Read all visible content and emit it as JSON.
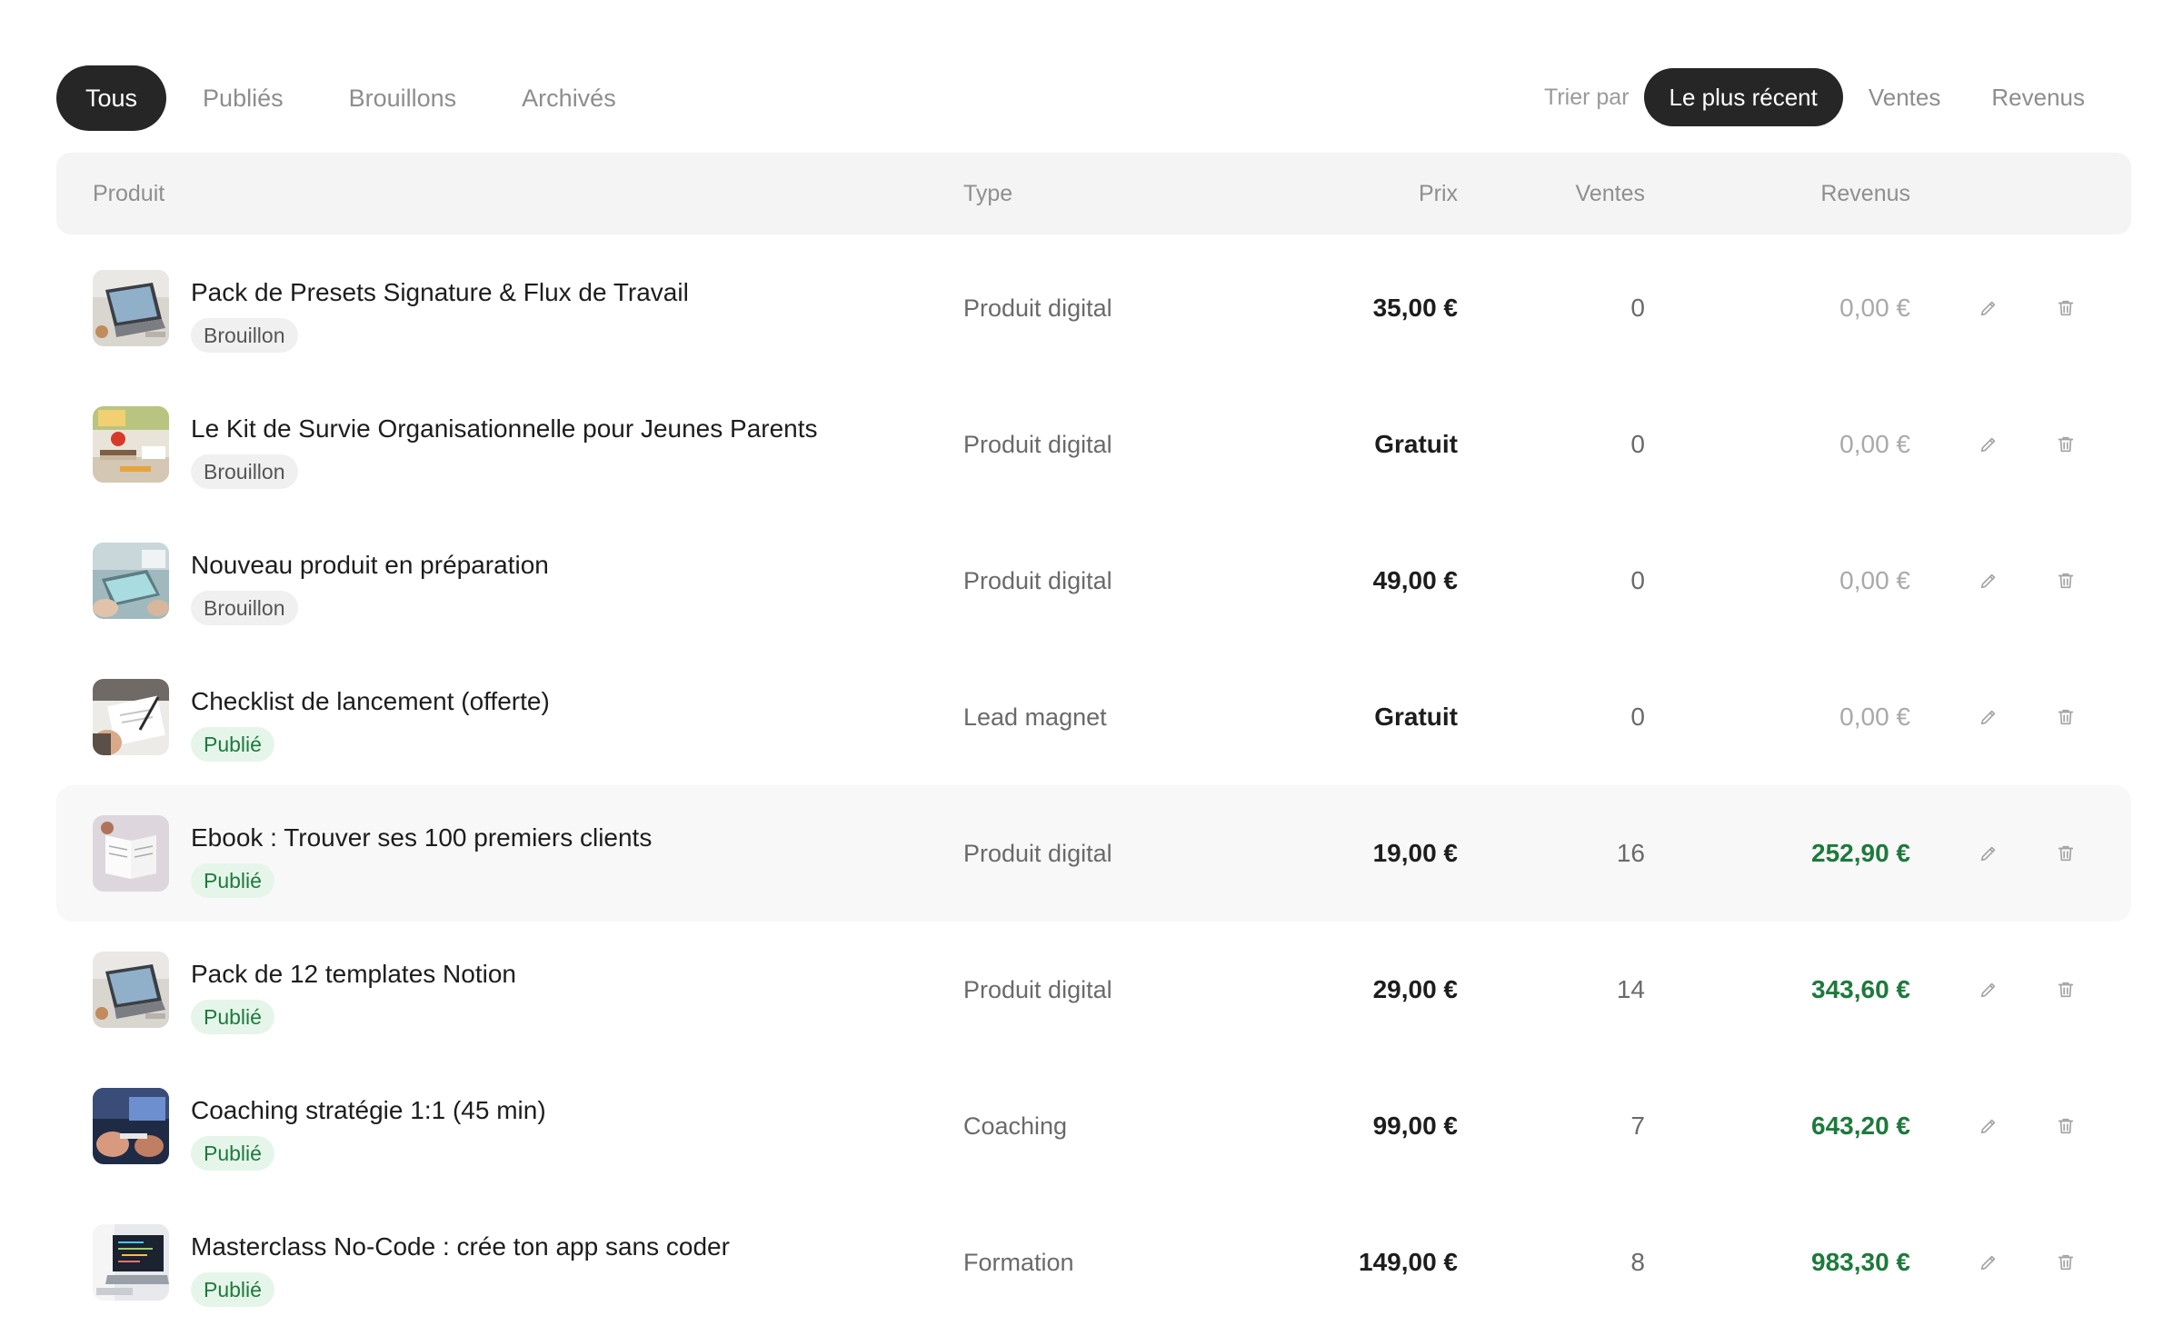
{
  "filters": {
    "tabs": [
      "Tous",
      "Publiés",
      "Brouillons",
      "Archivés"
    ],
    "active": 0
  },
  "sort": {
    "label": "Trier par",
    "options": [
      "Le plus récent",
      "Ventes",
      "Revenus"
    ],
    "active": 0
  },
  "columns": {
    "product": "Produit",
    "type": "Type",
    "price": "Prix",
    "sales": "Ventes",
    "revenue": "Revenus"
  },
  "products": [
    {
      "name": "Pack de Presets Signature & Flux de Travail",
      "status": "Brouillon",
      "status_kind": "draft",
      "type": "Produit digital",
      "price": "35,00 €",
      "sales": "0",
      "revenue": "0,00 €",
      "thumb": "laptop"
    },
    {
      "name": "Le Kit de Survie Organisationnelle pour Jeunes Parents",
      "status": "Brouillon",
      "status_kind": "draft",
      "type": "Produit digital",
      "price": "Gratuit",
      "sales": "0",
      "revenue": "0,00 €",
      "thumb": "desk"
    },
    {
      "name": "Nouveau produit en préparation",
      "status": "Brouillon",
      "status_kind": "draft",
      "type": "Produit digital",
      "price": "49,00 €",
      "sales": "0",
      "revenue": "0,00 €",
      "thumb": "meeting"
    },
    {
      "name": "Checklist de lancement (offerte)",
      "status": "Publié",
      "status_kind": "pub",
      "type": "Lead magnet",
      "price": "Gratuit",
      "sales": "0",
      "revenue": "0,00 €",
      "thumb": "writing"
    },
    {
      "name": "Ebook : Trouver ses 100 premiers clients",
      "status": "Publié",
      "status_kind": "pub",
      "type": "Produit digital",
      "price": "19,00 €",
      "sales": "16",
      "revenue": "252,90 €",
      "thumb": "book"
    },
    {
      "name": "Pack de 12 templates Notion",
      "status": "Publié",
      "status_kind": "pub",
      "type": "Produit digital",
      "price": "29,00 €",
      "sales": "14",
      "revenue": "343,60 €",
      "thumb": "laptop"
    },
    {
      "name": "Coaching stratégie 1:1 (45 min)",
      "status": "Publié",
      "status_kind": "pub",
      "type": "Coaching",
      "price": "99,00 €",
      "sales": "7",
      "revenue": "643,20 €",
      "thumb": "coaching"
    },
    {
      "name": "Masterclass No-Code : crée ton app sans coder",
      "status": "Publié",
      "status_kind": "pub",
      "type": "Formation",
      "price": "149,00 €",
      "sales": "8",
      "revenue": "983,30 €",
      "thumb": "code"
    }
  ],
  "highlighted_row": 4,
  "icons": {
    "edit": "pencil-icon",
    "delete": "trash-icon"
  },
  "colors": {
    "accent_dark": "#262626",
    "positive": "#1d7a3c",
    "published_bg": "#e6f5ea"
  }
}
